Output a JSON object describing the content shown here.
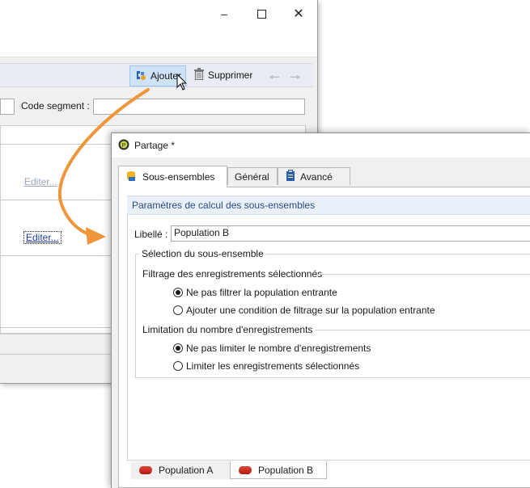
{
  "background_window": {
    "toolbar": {
      "add_label": "Ajouter",
      "delete_label": "Supprimer"
    },
    "form": {
      "code_segment_label": "Code segment :"
    },
    "links": {
      "edit1": "Editer...",
      "edit2": "Editer..."
    }
  },
  "dialog": {
    "title": "Partage *",
    "tabs": [
      {
        "label": "Sous-ensembles",
        "active": true
      },
      {
        "label": "Général",
        "active": false
      },
      {
        "label": "Avancé",
        "active": false
      }
    ],
    "pane_header": "Paramètres de calcul des sous-ensembles",
    "libelle_label": "Libellé :",
    "libelle_value": "Population B",
    "selection_group": {
      "title": "Sélection du sous-ensemble",
      "filter_section": {
        "title": "Filtrage des enregistrements sélectionnés",
        "options": [
          {
            "label": "Ne pas filtrer la population entrante",
            "checked": true
          },
          {
            "label": "Ajouter une condition de filtrage sur la population entrante",
            "checked": false
          }
        ]
      },
      "limit_section": {
        "title": "Limitation du nombre d'enregistrements",
        "options": [
          {
            "label": "Ne pas limiter le nombre d'enregistrements",
            "checked": true
          },
          {
            "label": "Limiter les enregistrements sélectionnés",
            "checked": false
          }
        ]
      }
    },
    "bottom_tabs": [
      {
        "label": "Population A",
        "active": false
      },
      {
        "label": "Population B",
        "active": true
      }
    ]
  },
  "colors": {
    "arrow": "#f0963a",
    "accent": "#2b4a7f"
  }
}
